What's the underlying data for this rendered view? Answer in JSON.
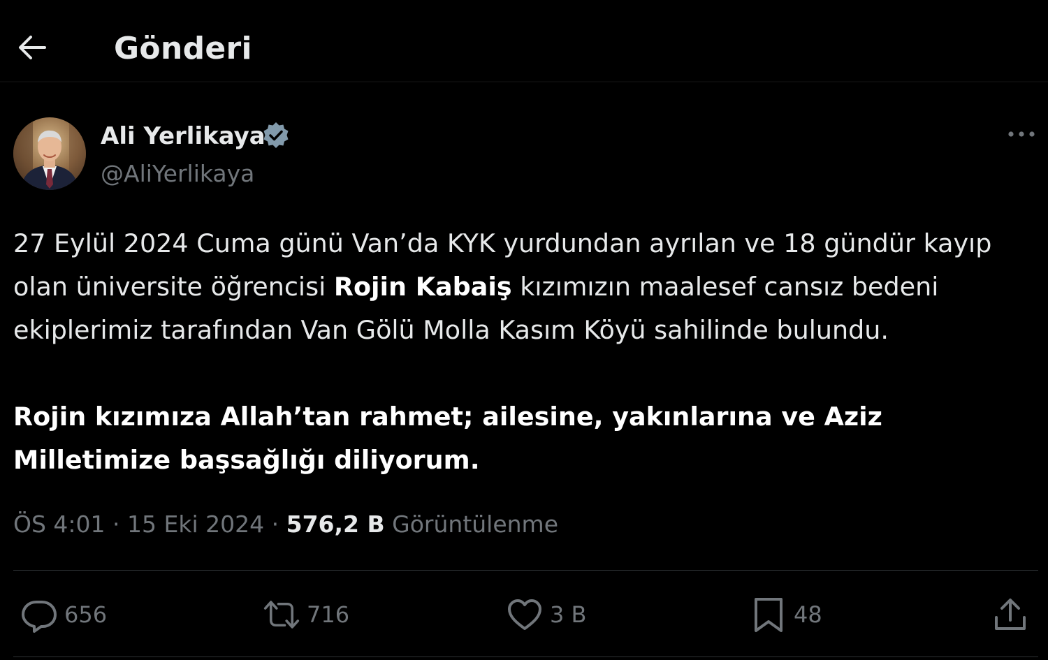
{
  "header": {
    "title": "Gönderi",
    "back_icon": "arrow-left-icon"
  },
  "author": {
    "name": "Ali Yerlikaya",
    "handle": "@AliYerlikaya",
    "verified": true,
    "verified_color": "#829aab"
  },
  "tweet": {
    "p1_a": "27 Eylül 2024 Cuma günü Van’da KYK yurdundan ayrılan ve 18 gündür kayıp olan üniversite öğrencisi ",
    "p1_bold": "Rojin Kabaiş",
    "p1_b": " kızımızın maalesef cansız bedeni ekiplerimiz tarafından Van Gölü Molla Kasım Köyü sahilinde bulundu.",
    "p2_bold": "Rojin kızımıza Allah’tan rahmet; ailesine, yakınlarına ve Aziz Milletimize başsağlığı diliyorum."
  },
  "meta": {
    "time": "ÖS 4:01",
    "separator": "·",
    "date": "15 Eki 2024",
    "views_count": "576,2 B",
    "views_label": "Görüntülenme"
  },
  "actions": {
    "reply_count": "656",
    "retweet_count": "716",
    "like_count": "3 B",
    "bookmark_count": "48"
  },
  "colors": {
    "background": "#000000",
    "text_primary": "#e7e9ea",
    "text_secondary": "#71767b",
    "divider": "#2f3336"
  }
}
